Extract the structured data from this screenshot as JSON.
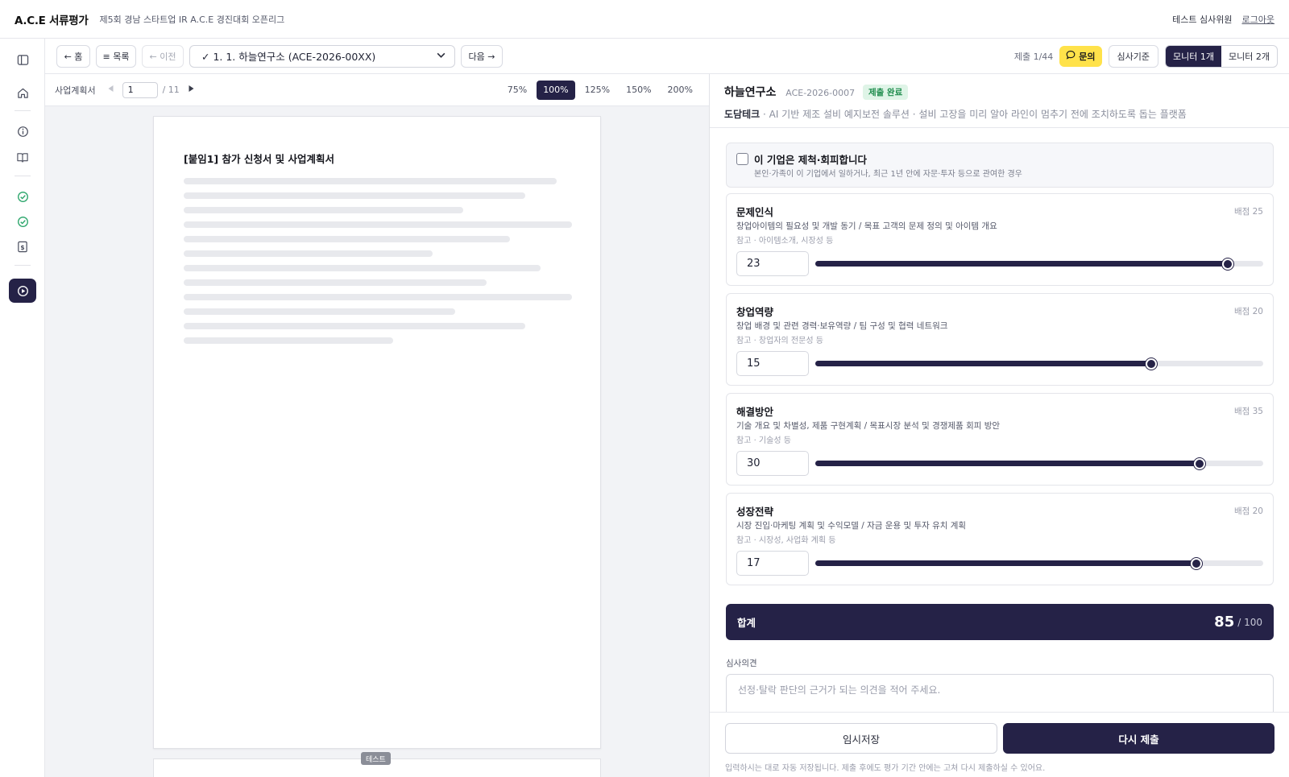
{
  "header": {
    "brand": "A.C.E 서류평가",
    "subtitle": "제5회 경남 스타트업 IR A.C.E 경진대회 오픈리그",
    "user": "테스트 심사위원",
    "logout": "로그아웃"
  },
  "toolbar": {
    "home": "← 홈",
    "list": "≡ 목록",
    "prev": "← 이전",
    "selected": "✓ 1. 1. 하늘연구소 (ACE-2026-00XX)",
    "next": "다음 →",
    "count": "제출 1/44",
    "inquiry": "문의",
    "criteria": "심사기준",
    "monitor1": "모니터 1개",
    "monitor2": "모니터 2개"
  },
  "viewer": {
    "doc_label": "사업계획서",
    "page": "1",
    "total": "/ 11",
    "zooms": [
      "75%",
      "100%",
      "125%",
      "150%",
      "200%"
    ],
    "zoom_selected": "100%",
    "doc_title": "[붙임1] 참가 신청서 및 사업계획서",
    "badge": "테스트"
  },
  "panel": {
    "company": "하늘연구소",
    "company_id": "ACE-2026-0007",
    "status": "제출 완료",
    "team": "도담테크",
    "description": " · AI 기반 제조 설비 예지보전 솔루션 · 설비 고장을 미리 알아 라인이 멈추기 전에 조치하도록 돕는 플랫폼",
    "coi_title": "이 기업은 제척·회피합니다",
    "coi_desc": "본인·가족이 이 기업에서 일하거나, 최근 1년 안에 자문·투자 등으로 관여한 경우",
    "criteria": [
      {
        "name": "문제인식",
        "points": "배점 25",
        "desc": "창업아이템의 필요성 및 개발 동기 / 목표 고객의 문제 정의 및 아이템 개요",
        "ref": "참고 · 아이템소개, 시장성 등",
        "score": "23",
        "max": 25
      },
      {
        "name": "창업역량",
        "points": "배점 20",
        "desc": "창업 배경 및 관련 경력·보유역량 / 팀 구성 및 협력 네트워크",
        "ref": "참고 · 창업자의 전문성 등",
        "score": "15",
        "max": 20
      },
      {
        "name": "해결방안",
        "points": "배점 35",
        "desc": "기술 개요 및 차별성, 제품 구현계획 / 목표시장 분석 및 경쟁제품 회피 방안",
        "ref": "참고 · 기술성 등",
        "score": "30",
        "max": 35
      },
      {
        "name": "성장전략",
        "points": "배점 20",
        "desc": "시장 진입·마케팅 계획 및 수익모델 / 자금 운용 및 투자 유치 계획",
        "ref": "참고 · 시장성, 사업화 계획 등",
        "score": "17",
        "max": 20
      }
    ],
    "sum_label": "합계",
    "sum_value": "85",
    "sum_max": "/ 100",
    "opinion_label": "심사의견",
    "opinion_placeholder": "선정·탈락 판단의 근거가 되는 의견을 적어 주세요.",
    "save_draft": "임시저장",
    "resubmit": "다시 제출",
    "note": "입력하시는 대로 자동 저장됩니다. 제출 후에도 평가 기간 안에는 고쳐 다시 제출하실 수 있어요."
  },
  "colors": {
    "primary": "#252247",
    "accent": "#ffe24a",
    "success": "#1c8b4b"
  }
}
